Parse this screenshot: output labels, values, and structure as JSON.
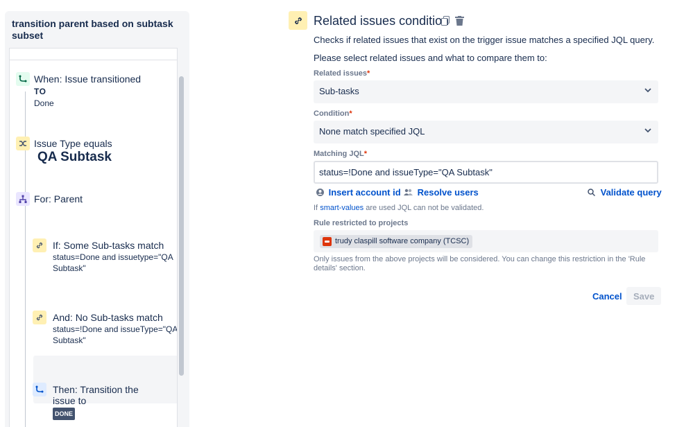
{
  "sidebar": {
    "rule_title": "transition parent based on subtask subset",
    "components": [
      {
        "type": "trigger",
        "icon": "trigger-icon",
        "title": "When: Issue transitioned",
        "to_label": "TO",
        "detail": "Done"
      },
      {
        "type": "condition",
        "icon": "shuffle-icon",
        "title": "Issue Type equals",
        "detail": "QA Subtask"
      },
      {
        "type": "branch",
        "icon": "branch-icon",
        "title": "For: Parent"
      },
      {
        "type": "condition",
        "icon": "link-icon",
        "title": "If: Some Sub-tasks match",
        "detail": "status=Done and issuetype=\"QA Subtask\""
      },
      {
        "type": "condition",
        "icon": "link-icon",
        "title": "And: No Sub-tasks match",
        "detail": "status=!Done and issueType=\"QA Subtask\"",
        "selected": true
      },
      {
        "type": "action",
        "icon": "transition-icon",
        "title": "Then: Transition the issue to",
        "status_lozenge": "DONE"
      }
    ]
  },
  "condition_panel": {
    "icon": "link-icon",
    "title": "Related issues condition",
    "description": "Checks if related issues that exist on the trigger issue matches a specified JQL query.",
    "prompt": "Please select related issues and what to compare them to:",
    "related_issues": {
      "label": "Related issues",
      "value": "Sub-tasks"
    },
    "condition": {
      "label": "Condition",
      "value": "None match specified JQL"
    },
    "matching_jql": {
      "label": "Matching JQL",
      "value": "status=!Done and issueType=\"QA Subtask\""
    },
    "links": {
      "insert_account": "Insert account id",
      "resolve_users": "Resolve users",
      "validate_query": "Validate query"
    },
    "smart_values_note": {
      "prefix": "If",
      "link": "smart-values",
      "suffix": "are used JQL can not be validated."
    },
    "restricted": {
      "label": "Rule restricted to projects",
      "project": "trudy claspill software company (TCSC)"
    },
    "restriction_note": "Only issues from the above projects will be considered. You can change this restriction in the 'Rule details' section.",
    "buttons": {
      "cancel": "Cancel",
      "save": "Save"
    }
  }
}
